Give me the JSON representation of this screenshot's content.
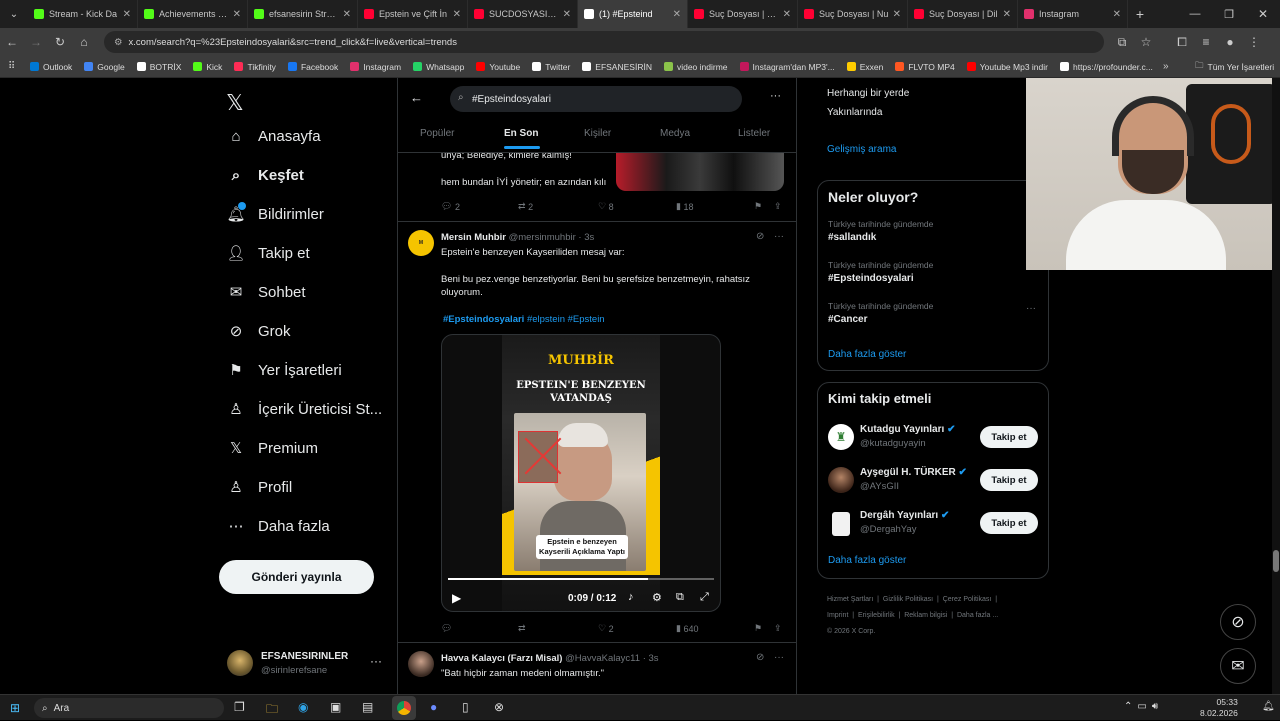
{
  "browser": {
    "tabs": [
      {
        "title": "Stream - Kick Da",
        "color": "#53fc18"
      },
      {
        "title": "Achievements - K",
        "color": "#53fc18"
      },
      {
        "title": "efsanesirin Stream",
        "color": "#53fc18"
      },
      {
        "title": "Epstein ve Çift İn",
        "color": "#ff0033"
      },
      {
        "title": "SUCDOSYASI - Yo",
        "color": "#ff0033"
      },
      {
        "title": "(1) #Epsteind",
        "color": "#ffffff"
      },
      {
        "title": "Suç Dosyası | Met",
        "color": "#ff0033"
      },
      {
        "title": "Suç Dosyası | Nu",
        "color": "#ff0033"
      },
      {
        "title": "Suç Dosyası | Dil",
        "color": "#ff0033"
      },
      {
        "title": "Instagram",
        "color": "#e1306c"
      }
    ],
    "url": "x.com/search?q=%23Epsteindosyalari&src=trend_click&f=live&vertical=trends",
    "bookmarks": [
      {
        "label": "Outlook",
        "color": "#0078d4"
      },
      {
        "label": "Google",
        "color": "#4285f4"
      },
      {
        "label": "BOTRİX",
        "color": "#ffffff"
      },
      {
        "label": "Kick",
        "color": "#53fc18"
      },
      {
        "label": "Tikfinity",
        "color": "#fe2c55"
      },
      {
        "label": "Facebook",
        "color": "#1877f2"
      },
      {
        "label": "Instagram",
        "color": "#e1306c"
      },
      {
        "label": "Whatsapp",
        "color": "#25d366"
      },
      {
        "label": "Youtube",
        "color": "#ff0000"
      },
      {
        "label": "Twitter",
        "color": "#ffffff"
      },
      {
        "label": "EFSANESİRİN",
        "color": "#ffffff"
      },
      {
        "label": "video indirme",
        "color": "#8bc34a"
      },
      {
        "label": "Instagram'dan MP3'...",
        "color": "#c2185b"
      },
      {
        "label": "Exxen",
        "color": "#ffcc00"
      },
      {
        "label": "FLVTO MP4",
        "color": "#ff5722"
      },
      {
        "label": "Youtube Mp3 indir",
        "color": "#ff0000"
      },
      {
        "label": "https://profounder.c...",
        "color": "#ffffff"
      }
    ],
    "other_bookmarks": "Tüm Yer İşaretleri"
  },
  "nav": {
    "items": [
      {
        "label": "Anasayfa"
      },
      {
        "label": "Keşfet"
      },
      {
        "label": "Bildirimler"
      },
      {
        "label": "Takip et"
      },
      {
        "label": "Sohbet"
      },
      {
        "label": "Grok"
      },
      {
        "label": "Yer İşaretleri"
      },
      {
        "label": "İçerik Üreticisi St..."
      },
      {
        "label": "Premium"
      },
      {
        "label": "Profil"
      },
      {
        "label": "Daha fazla"
      }
    ],
    "post_button": "Gönderi yayınla",
    "account": {
      "name": "EFSANESIRINLER",
      "handle": "@sirinlerefsane"
    }
  },
  "main": {
    "search_value": "#Epsteindosyalari",
    "tabs": [
      "Popüler",
      "En Son",
      "Kişiler",
      "Medya",
      "Listeler"
    ],
    "prev_tweet": {
      "text1": "unya; Belediye, kimlere kalmış!",
      "text2": "hem bundan İYİ yönetir; en azından kılı",
      "replies": "2",
      "retweets": "2",
      "likes": "8",
      "views": "18"
    },
    "tweet": {
      "name": "Mersin Muhbir",
      "handle": "@mersinmuhbir",
      "time": "· 3s",
      "line1": "Epstein'e benzeyen Kayseriliden mesaj var:",
      "line2": "Beni bu pez.venge benzetiyorlar. Beni bu şerefsize benzetmeyin, rahatsız oluyorum.",
      "hashtags": [
        "#Epsteindosyalari",
        "#elpstein",
        "#Epstein"
      ],
      "video": {
        "brand": "MUHBİR",
        "headline": "EPSTEIN'E BENZEYEN VATANDAŞ",
        "caption": "Epstein e benzeyen Kayserili Açıklama Yaptı",
        "time": "0:09 / 0:12",
        "progress": 0.75
      },
      "replies": "",
      "retweets": "",
      "likes": "2",
      "views": "640"
    },
    "next_tweet": {
      "name": "Havva Kalaycı (Farzı Misal)",
      "handle": "@HavvaKalayc11",
      "time": "· 3s",
      "text": "\"Batı hiçbir zaman medeni olmamıştır.\""
    }
  },
  "right": {
    "location": {
      "line1": "Herhangi bir yerde",
      "line2": "Yakınlarında",
      "advanced": "Gelişmiş arama"
    },
    "trends": {
      "title": "Neler oluyor?",
      "items": [
        {
          "category": "Türkiye tarihinde gündemde",
          "tag": "#sallandık"
        },
        {
          "category": "Türkiye tarihinde gündemde",
          "tag": "#Epsteindosyalari"
        },
        {
          "category": "Türkiye tarihinde gündemde",
          "tag": "#Cancer"
        }
      ],
      "more": "Daha fazla göster"
    },
    "who_to_follow": {
      "title": "Kimi takip etmeli",
      "items": [
        {
          "name": "Kutadgu Yayınları",
          "handle": "@kutadguyayin",
          "button": "Takip et"
        },
        {
          "name": "Ayşegül H. TÜRKER",
          "handle": "@AYsGII",
          "button": "Takip et"
        },
        {
          "name": "Dergâh Yayınları",
          "handle": "@DergahYay",
          "button": "Takip et"
        }
      ],
      "more": "Daha fazla göster"
    },
    "footer": {
      "links": [
        "Hizmet Şartları",
        "Gizlilik Politikası",
        "Çerez Politikası",
        "Imprint",
        "Erişilebilirlik",
        "Reklam bilgisi",
        "Daha fazla ..."
      ],
      "copyright": "© 2026 X Corp."
    }
  },
  "taskbar": {
    "search": "Ara",
    "time": "05:33",
    "date": "8.02.2026"
  }
}
